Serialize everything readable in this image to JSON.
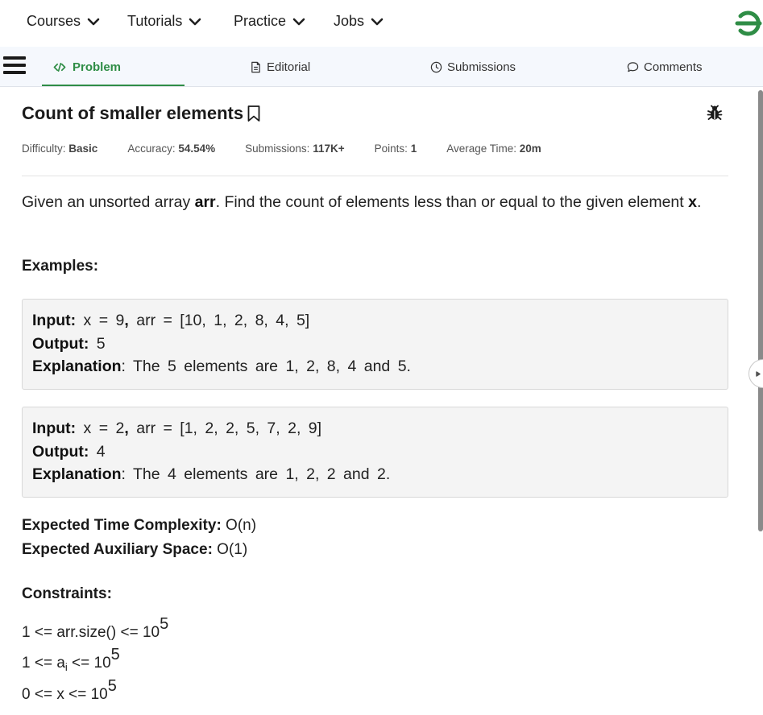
{
  "nav": {
    "items": [
      {
        "label": "Courses"
      },
      {
        "label": "Tutorials"
      },
      {
        "label": "Practice"
      },
      {
        "label": "Jobs"
      }
    ]
  },
  "tabs": [
    {
      "label": "Problem",
      "icon": "code-icon",
      "active": true
    },
    {
      "label": "Editorial",
      "icon": "document-icon",
      "active": false
    },
    {
      "label": "Submissions",
      "icon": "clock-icon",
      "active": false
    },
    {
      "label": "Comments",
      "icon": "comment-icon",
      "active": false
    }
  ],
  "problem": {
    "title": "Count of smaller elements",
    "meta": {
      "difficulty_label": "Difficulty:",
      "difficulty_value": "Basic",
      "accuracy_label": "Accuracy:",
      "accuracy_value": "54.54%",
      "submissions_label": "Submissions:",
      "submissions_value": "117K+",
      "points_label": "Points:",
      "points_value": "1",
      "avgtime_label": "Average Time:",
      "avgtime_value": "20m"
    },
    "description": {
      "part1": "Given an unsorted array ",
      "bold1": "arr",
      "part2": ". Find the count of elements less than or equal to the given element ",
      "bold2": "x",
      "part3": "."
    },
    "examples_heading": "Examples:",
    "examples": [
      {
        "input_label": "Input:",
        "input_pre": " x = 9",
        "input_comma": ",",
        "input_post": " arr = [10, 1, 2, 8, 4, 5]",
        "output_label": "Output:",
        "output_value": " 5",
        "explanation_label": "Explanation",
        "explanation_value": ": The 5 elements are 1, 2, 8, 4 and 5."
      },
      {
        "input_label": "Input:",
        "input_pre": " x = 2",
        "input_comma": ",",
        "input_post": " arr = [1, 2, 2, 5, 7, 2, 9]",
        "output_label": "Output:",
        "output_value": " 4",
        "explanation_label": "Explanation",
        "explanation_value": ": The 4 elements are 1, 2, 2 and 2."
      }
    ],
    "complexity": {
      "time_label": "Expected Time Complexity:",
      "time_value": " O(n)",
      "space_label": "Expected Auxiliary Space:",
      "space_value": " O(1)"
    },
    "constraints_heading": "Constraints:",
    "constraints": [
      {
        "pre": "1 <= arr.size() <= 10",
        "sup": "5"
      },
      {
        "pre": "1 <= a",
        "sub": "i",
        "mid": " <= 10",
        "sup": "5"
      },
      {
        "pre": "0 <= x <= 10",
        "sup": "5"
      }
    ]
  },
  "colors": {
    "accent": "#2f8d46",
    "tabbar_bg": "#f5f8fd",
    "example_bg": "#f4f4f4"
  }
}
